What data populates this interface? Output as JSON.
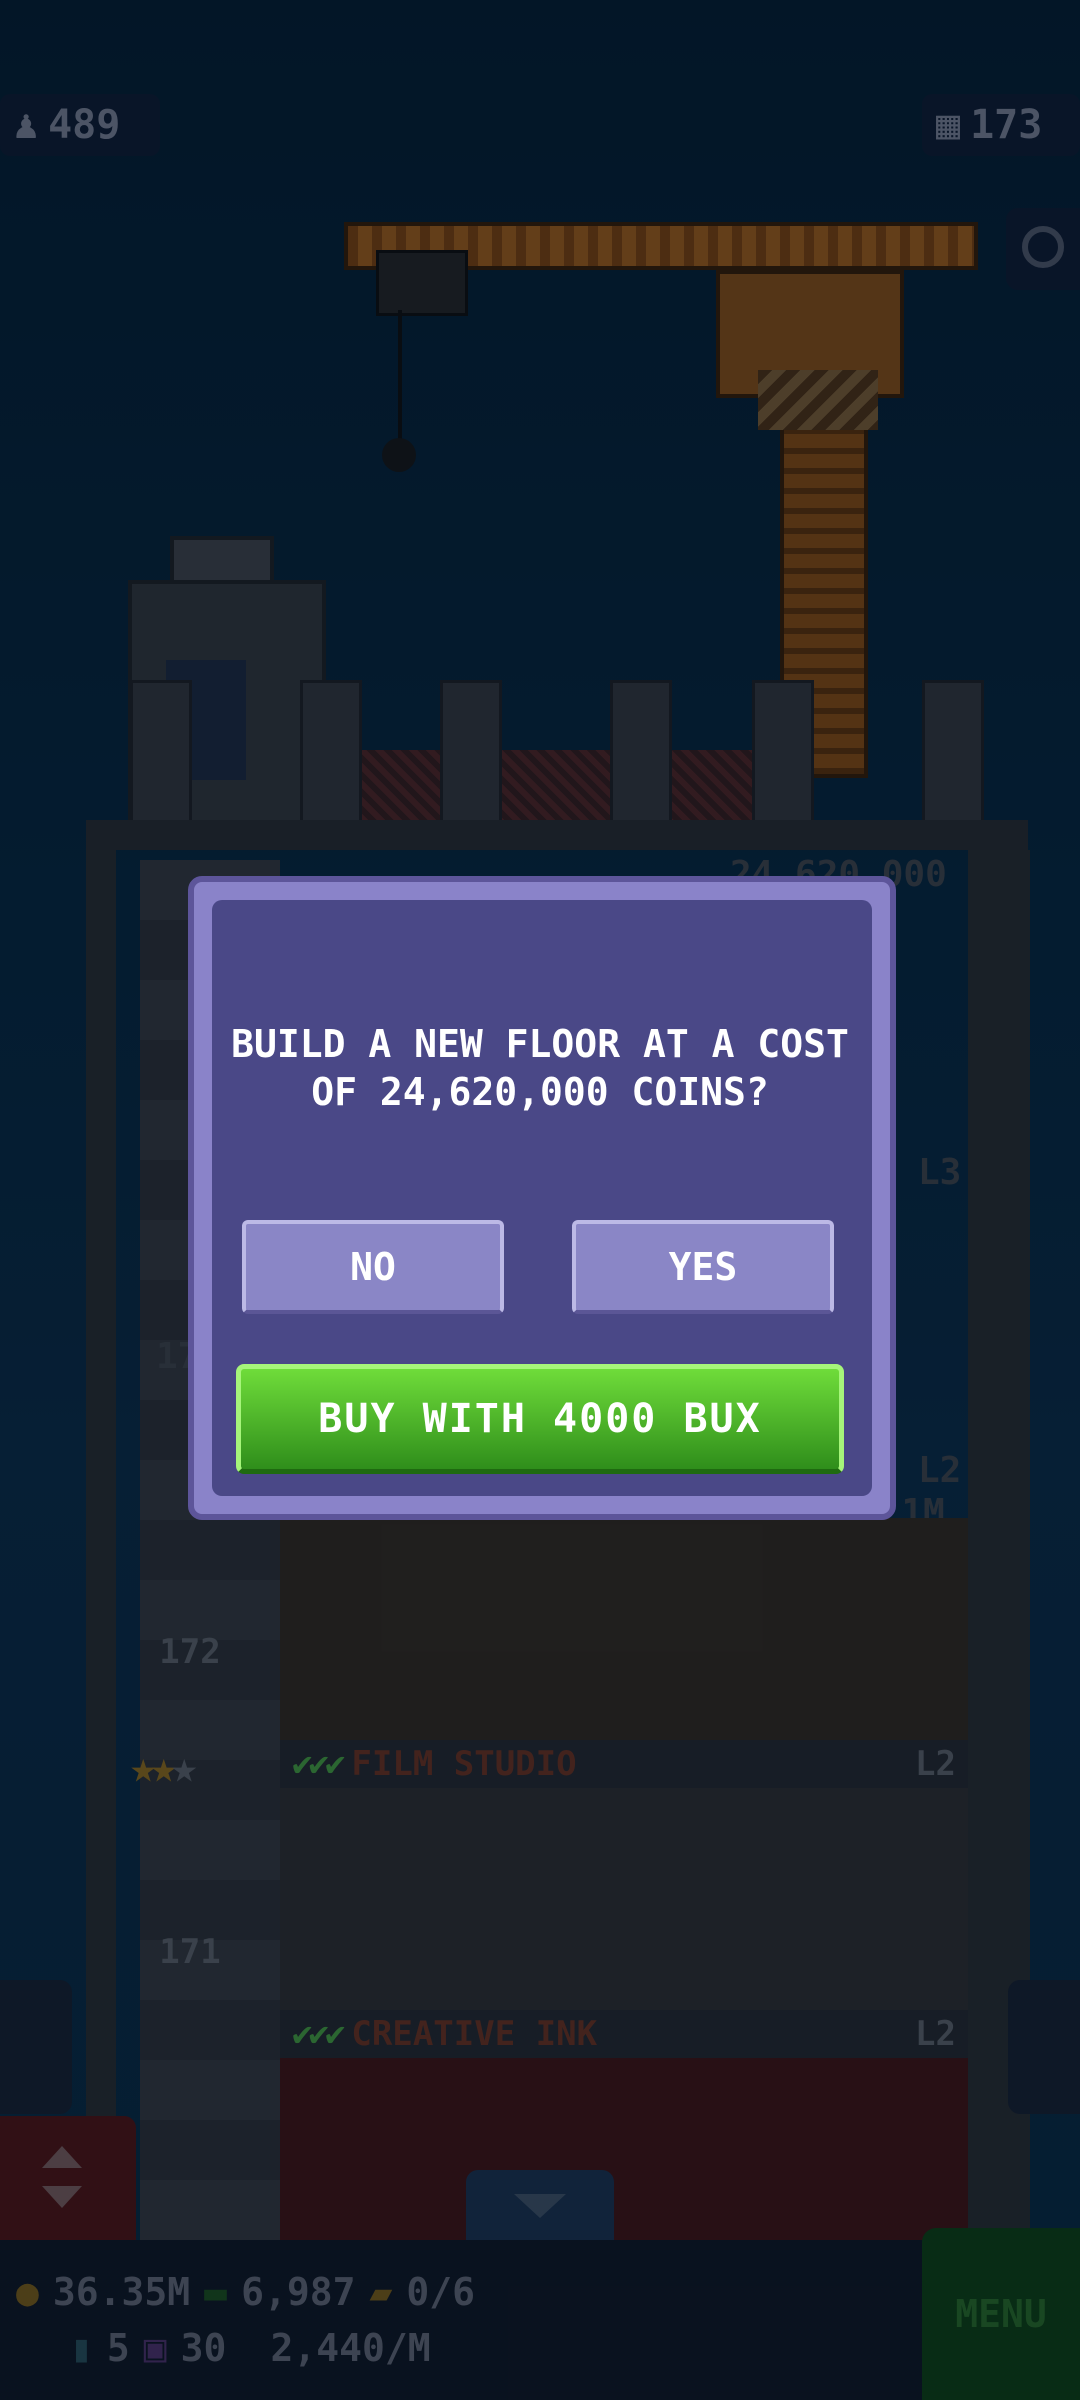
{
  "hud": {
    "population": "489",
    "floors": "173"
  },
  "tower": {
    "top_cost_ghost": "24,620,000",
    "floors": [
      {
        "number": "172",
        "name": "FILM STUDIO",
        "level": "L2"
      },
      {
        "number": "171",
        "name": "CREATIVE INK",
        "level": "L2"
      }
    ],
    "ghost_labels": {
      "l3": "L3",
      "l2a": "L2",
      "timer": "< 1M",
      "n17": "17"
    }
  },
  "dialog": {
    "message": "BUILD A NEW FLOOR AT A COST OF 24,620,000 COINS?",
    "no_label": "NO",
    "yes_label": "YES",
    "buy_label": "BUY WITH 4000 BUX"
  },
  "bottom_bar": {
    "coins": "36.35M",
    "bux": "6,987",
    "tickets": "0/6",
    "keys": "5",
    "tv": "30",
    "income": "2,440/M",
    "menu_label": "MENU"
  },
  "colors": {
    "sky": "#0a2f4b",
    "dialog_frame": "#8a83c9",
    "dialog_fill": "#4a4887",
    "buy_green": "#3fa81f"
  }
}
